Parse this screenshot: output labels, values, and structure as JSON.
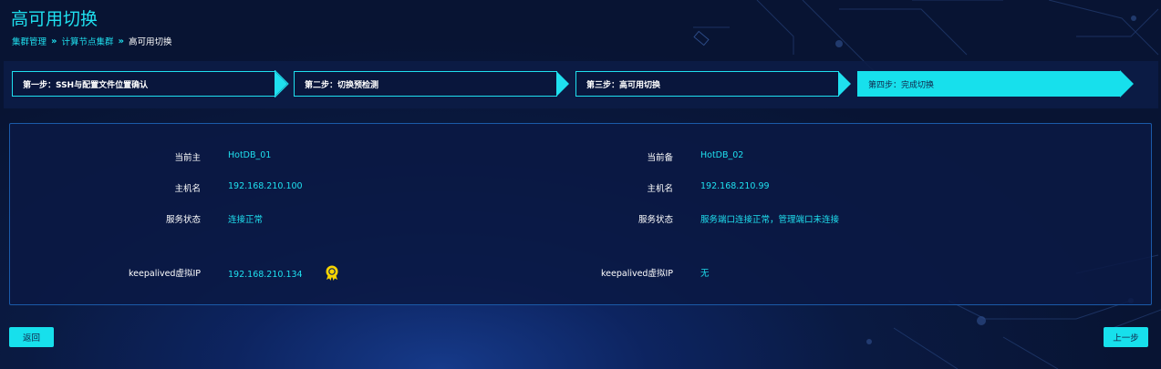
{
  "page": {
    "title": "高可用切换",
    "breadcrumb": [
      "集群管理",
      "计算节点集群",
      "高可用切换"
    ]
  },
  "steps": [
    {
      "label": "第一步：SSH与配置文件位置确认",
      "active": false
    },
    {
      "label": "第二步：切换预检测",
      "active": false
    },
    {
      "label": "第三步：高可用切换",
      "active": false
    },
    {
      "label": "第四步：完成切换",
      "active": true
    }
  ],
  "left": {
    "current_master_label": "当前主",
    "current_master_value": "HotDB_01",
    "hostname_label": "主机名",
    "hostname_value": "192.168.210.100",
    "service_status_label": "服务状态",
    "service_status_value": "连接正常",
    "vip_label": "keepalived虚拟IP",
    "vip_value": "192.168.210.134",
    "vip_icon": "badge-icon"
  },
  "right": {
    "current_backup_label": "当前备",
    "current_backup_value": "HotDB_02",
    "hostname_label": "主机名",
    "hostname_value": "192.168.210.99",
    "service_status_label": "服务状态",
    "service_status_value": "服务端口连接正常，管理端口未连接",
    "vip_label": "keepalived虚拟IP",
    "vip_value": "无"
  },
  "buttons": {
    "back": "返回",
    "prev_step": "上一步"
  },
  "colors": {
    "accent": "#1fe0ef",
    "panel_border": "#1b5aa8",
    "badge": "#f7d400"
  }
}
